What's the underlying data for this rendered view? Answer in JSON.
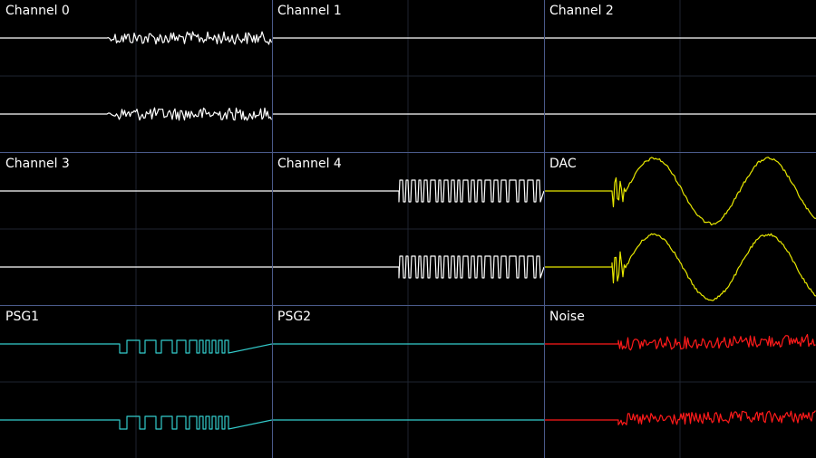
{
  "channels": [
    {
      "label": "Channel 0",
      "color": "#ffffff",
      "pattern": "noise-burst"
    },
    {
      "label": "Channel 1",
      "color": "#ffffff",
      "pattern": "flat"
    },
    {
      "label": "Channel 2",
      "color": "#ffffff",
      "pattern": "flat"
    },
    {
      "label": "Channel 3",
      "color": "#ffffff",
      "pattern": "flat"
    },
    {
      "label": "Channel 4",
      "color": "#ffffff",
      "pattern": "fm-pulse"
    },
    {
      "label": "DAC",
      "color": "#e8e800",
      "pattern": "dac-sine"
    },
    {
      "label": "PSG1",
      "color": "#33cccc",
      "pattern": "square"
    },
    {
      "label": "PSG2",
      "color": "#33cccc",
      "pattern": "flat"
    },
    {
      "label": "Noise",
      "color": "#ff1a1a",
      "pattern": "red-noise"
    }
  ],
  "colors": {
    "background": "#000000",
    "separator": "#4a5a8a",
    "grid": "#1e2430"
  }
}
